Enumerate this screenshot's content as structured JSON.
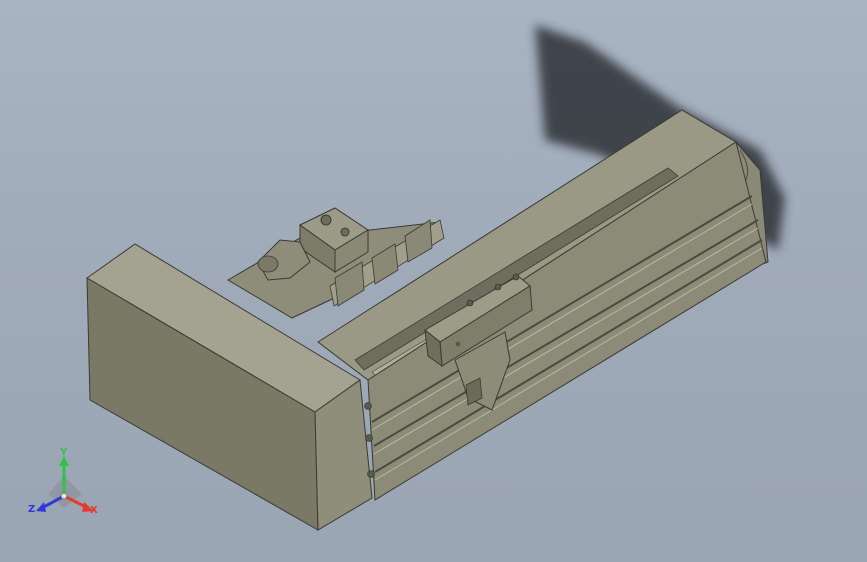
{
  "viewport": {
    "background_color": "#a3aebc",
    "model_color": "#8e8d79",
    "shadow_color": "#2e3338"
  },
  "triad": {
    "x_label": "X",
    "y_label": "Y",
    "z_label": "Z",
    "x_color": "#e53a2e",
    "y_color": "#31c24a",
    "z_color": "#2e3ad8"
  }
}
